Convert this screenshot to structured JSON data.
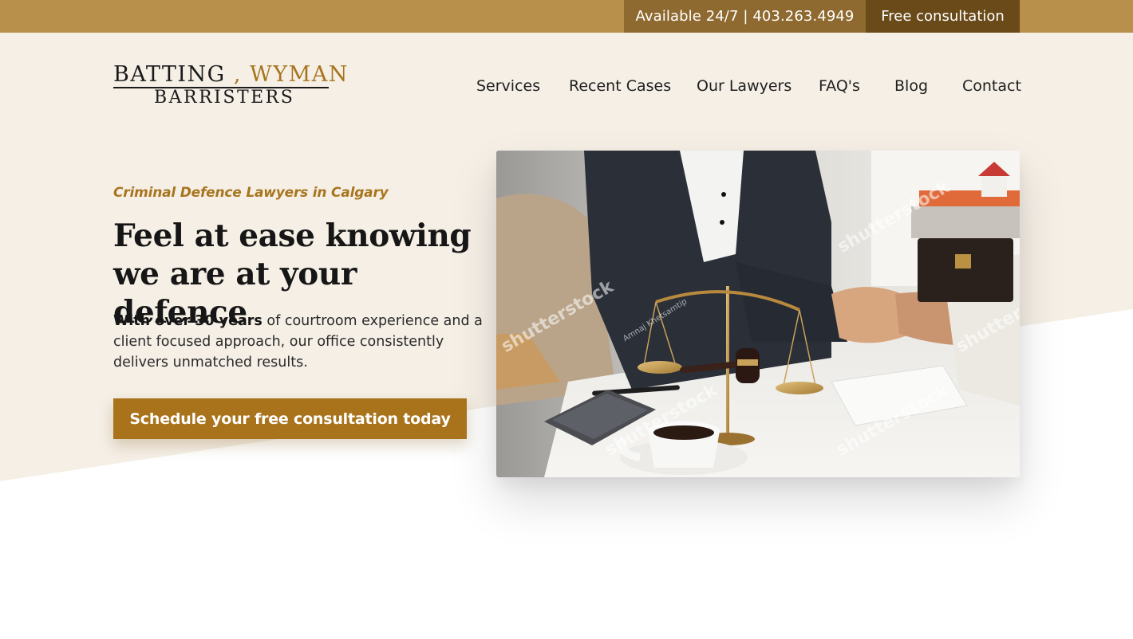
{
  "topbar": {
    "phone_text": "Available 24/7 | 403.263.4949",
    "cta_label": "Free consultation"
  },
  "logo": {
    "name_part1": "BATTING",
    "separator": " , ",
    "name_part2": "WYMAN",
    "subtitle": "BARRISTERS"
  },
  "nav": {
    "items": [
      {
        "label": "Services"
      },
      {
        "label": "Recent Cases"
      },
      {
        "label": "Our Lawyers"
      },
      {
        "label": "FAQ's"
      },
      {
        "label": "Blog"
      },
      {
        "label": "Contact"
      }
    ]
  },
  "hero": {
    "eyebrow": "Criminal Defence Lawyers in Calgary",
    "headline": "Feel at ease knowing we are at your defence",
    "intro_bold": "With over 30 years",
    "intro_rest": " of courtroom experience and a client focused approach, our office consistently delivers unmatched results.",
    "button_label": "Schedule your free consultation today"
  },
  "photo": {
    "watermark": "shutterstock",
    "credit": "Amnaj Khetsamtip"
  },
  "colors": {
    "topbar": "#b98f4c",
    "topbar_phone": "#8f6a30",
    "topbar_cta": "#6a4a18",
    "hero_bg": "#f5efe6",
    "accent": "#a8751e",
    "button": "#a8731a"
  }
}
